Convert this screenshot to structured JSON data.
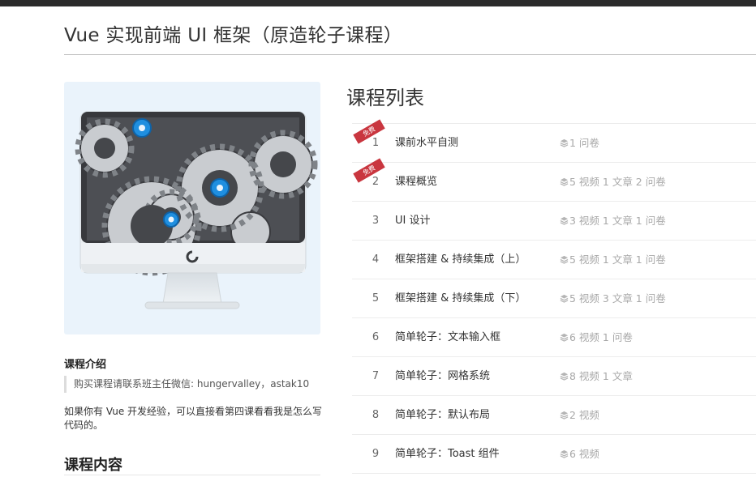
{
  "page": {
    "title": "Vue 实现前端 UI 框架（原造轮子课程）"
  },
  "intro": {
    "heading": "课程介绍",
    "quote": "购买课程请联系班主任微信: hungervalley，astak10",
    "text": "如果你有 Vue 开发经验，可以直接看第四课看看我是怎么写代码的。"
  },
  "content": {
    "heading": "课程内容"
  },
  "course_list": {
    "heading": "课程列表",
    "free_label": "免费",
    "items": [
      {
        "num": "1",
        "title": "课前水平自测",
        "meta": "1 问卷",
        "free": true
      },
      {
        "num": "2",
        "title": "课程概览",
        "meta": "5 视频 1 文章 2 问卷",
        "free": true
      },
      {
        "num": "3",
        "title": "UI 设计",
        "meta": "3 视频 1 文章 1 问卷",
        "free": false
      },
      {
        "num": "4",
        "title": "框架搭建 & 持续集成（上）",
        "meta": "5 视频 1 文章 1 问卷",
        "free": false
      },
      {
        "num": "5",
        "title": "框架搭建 & 持续集成（下）",
        "meta": "5 视频 3 文章 1 问卷",
        "free": false
      },
      {
        "num": "6",
        "title": "简单轮子：文本输入框",
        "meta": "6 视频 1 问卷",
        "free": false
      },
      {
        "num": "7",
        "title": "简单轮子：网格系统",
        "meta": "8 视频 1 文章",
        "free": false
      },
      {
        "num": "8",
        "title": "简单轮子：默认布局",
        "meta": "2 视频",
        "free": false
      },
      {
        "num": "9",
        "title": "简单轮子：Toast 组件",
        "meta": "6 视频",
        "free": false
      }
    ]
  },
  "colors": {
    "accent_blue": "#1f8fe0",
    "ribbon_red": "#c9363f",
    "meta_gray": "#a8a8a8"
  },
  "icons": {
    "meta_icon": "layers-icon",
    "cover": "monitor-with-gears-illustration"
  }
}
